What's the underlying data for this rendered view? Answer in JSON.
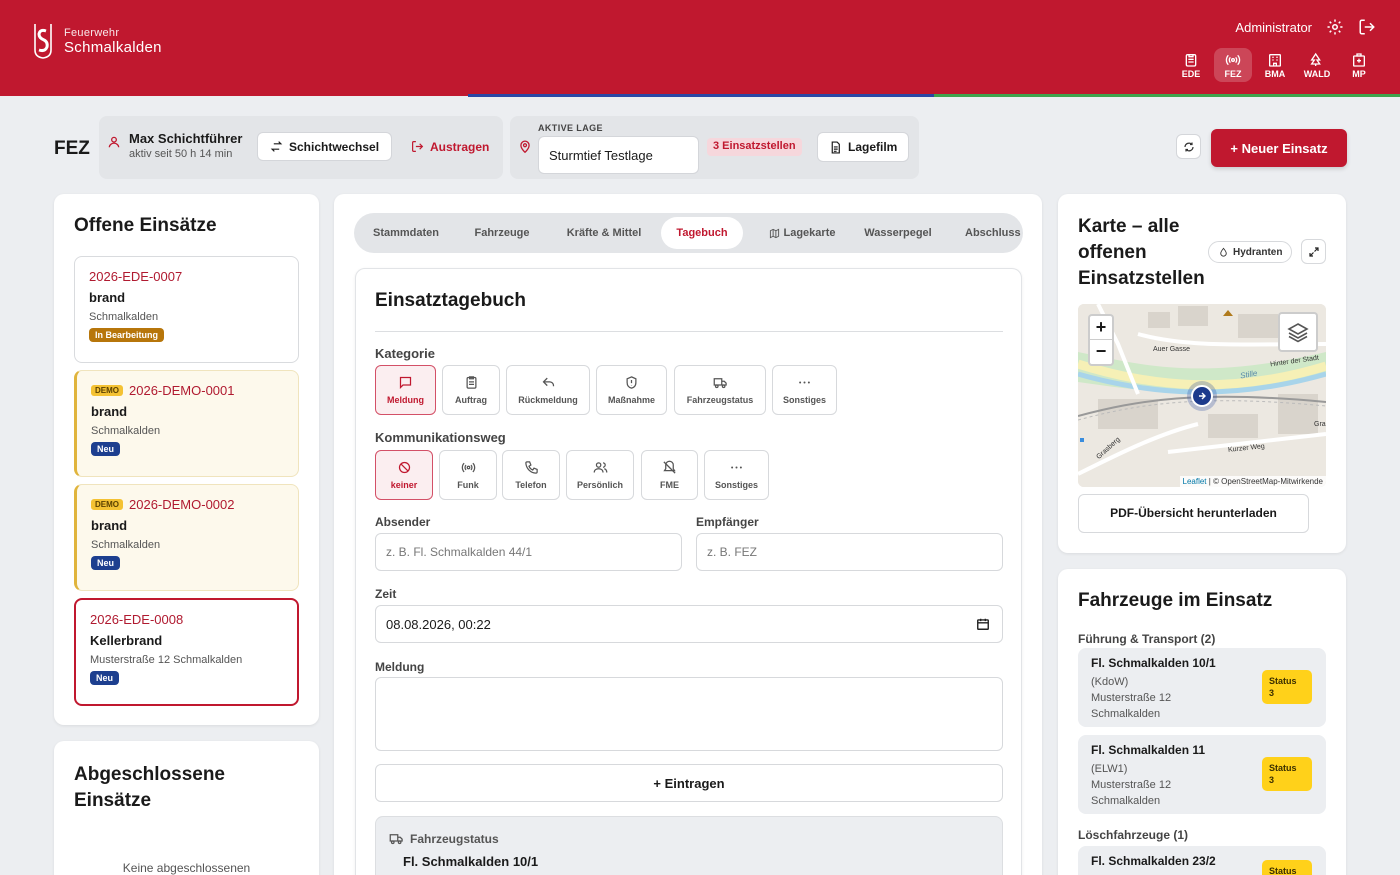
{
  "brand": {
    "line1": "Feuerwehr",
    "line2": "Schmalkalden"
  },
  "user": {
    "name": "Administrator"
  },
  "modules": [
    {
      "label": "EDE",
      "icon": "clipboard-icon"
    },
    {
      "label": "FEZ",
      "icon": "radio-icon",
      "active": true
    },
    {
      "label": "BMA",
      "icon": "building-icon"
    },
    {
      "label": "WALD",
      "icon": "trees-icon"
    },
    {
      "label": "MP",
      "icon": "hospital-icon"
    }
  ],
  "colors": {
    "primary": "#c0182f",
    "accent_blue": "#2a47a5",
    "accent_green": "#3fa34d",
    "status_yellow": "#ffd11a"
  },
  "status_bar": {
    "module": "FEZ",
    "shift_leader": "Max Schichtführer",
    "shift_since": "aktiv seit 50 h 14 min",
    "shift_change": "Schichtwechsel",
    "sign_out": "Austragen",
    "active_label": "AKTIVE LAGE",
    "active_situation": "Sturmtief Testlage",
    "incident_sites": "3 Einsatzstellen",
    "film": "Lagefilm",
    "new_incident": "+ Neuer Einsatz"
  },
  "open_incidents": {
    "title": "Offene Einsätze",
    "items": [
      {
        "id": "2026-EDE-0007",
        "type": "brand",
        "location": "Schmalkalden",
        "status": "In Bearbeitung",
        "status_color": "#b7760b"
      },
      {
        "id": "2026-DEMO-0001",
        "demo": "DEMO",
        "type": "brand",
        "location": "Schmalkalden",
        "status": "Neu",
        "status_color": "#1d3f8f"
      },
      {
        "id": "2026-DEMO-0002",
        "demo": "DEMO",
        "type": "brand",
        "location": "Schmalkalden",
        "status": "Neu",
        "status_color": "#1d3f8f"
      },
      {
        "id": "2026-EDE-0008",
        "type": "Kellerbrand",
        "location": "Musterstraße 12 Schmalkalden",
        "status": "Neu",
        "status_color": "#1d3f8f"
      }
    ]
  },
  "closed_incidents": {
    "title": "Abgeschlossene Einsätze",
    "empty": "Keine abgeschlossenen"
  },
  "tabs": [
    {
      "label": "Stammdaten"
    },
    {
      "label": "Fahrzeuge"
    },
    {
      "label": "Kräfte & Mittel"
    },
    {
      "label": "Tagebuch",
      "active": true
    },
    {
      "label": "Lagekarte",
      "icon": "map-icon"
    },
    {
      "label": "Wasserpegel"
    },
    {
      "label": "Abschluss"
    }
  ],
  "journal": {
    "title": "Einsatztagebuch",
    "category_label": "Kategorie",
    "categories": [
      {
        "label": "Meldung",
        "icon": "message-icon",
        "active": true
      },
      {
        "label": "Auftrag",
        "icon": "clipboard-icon"
      },
      {
        "label": "Rückmeldung",
        "icon": "reply-icon"
      },
      {
        "label": "Maßnahme",
        "icon": "shield-icon"
      },
      {
        "label": "Fahrzeugstatus",
        "icon": "truck-icon"
      },
      {
        "label": "Sonstiges",
        "icon": "dots-icon"
      }
    ],
    "comm_label": "Kommunikationsweg",
    "comm": [
      {
        "label": "keiner",
        "icon": "ban-icon",
        "active": true
      },
      {
        "label": "Funk",
        "icon": "radio-icon"
      },
      {
        "label": "Telefon",
        "icon": "phone-icon"
      },
      {
        "label": "Persönlich",
        "icon": "users-icon"
      },
      {
        "label": "FME",
        "icon": "pager-icon"
      },
      {
        "label": "Sonstiges",
        "icon": "dots-icon"
      }
    ],
    "sender_label": "Absender",
    "sender_placeholder": "z. B. Fl. Schmalkalden 44/1",
    "recipient_label": "Empfänger",
    "recipient_placeholder": "z. B. FEZ",
    "time_label": "Zeit",
    "time_value": "08.08.2026, 00:22",
    "message_label": "Meldung",
    "submit": "+ Eintragen",
    "entry_category": "Fahrzeugstatus",
    "entry_vehicle": "Fl. Schmalkalden 10/1"
  },
  "map_panel": {
    "title": "Karte – alle offenen Einsatzstellen",
    "hydrants": "Hydranten",
    "zoom_in": "+",
    "zoom_out": "−",
    "streets": [
      "Auer Gasse",
      "Hinter der Stadt",
      "Stille",
      "Kurzer Weg",
      "Grasberg",
      "Gra"
    ],
    "attribution_leaflet": "Leaflet",
    "attribution_osm": "© OpenStreetMap-Mitwirkende",
    "pdf_button": "PDF-Übersicht herunterladen"
  },
  "vehicles_panel": {
    "title": "Fahrzeuge im Einsatz",
    "group1": "Führung & Transport (2)",
    "group2": "Löschfahrzeuge (1)",
    "vehicles": [
      {
        "name": "Fl. Schmalkalden 10/1",
        "type": "(KdoW)",
        "address": "Musterstraße 12 Schmalkalden",
        "status_label": "Status",
        "status_value": "3"
      },
      {
        "name": "Fl. Schmalkalden 11",
        "type": "(ELW1)",
        "address": "Musterstraße 12 Schmalkalden",
        "status_label": "Status",
        "status_value": "3"
      },
      {
        "name": "Fl. Schmalkalden 23/2",
        "status_label": "Status"
      }
    ]
  }
}
